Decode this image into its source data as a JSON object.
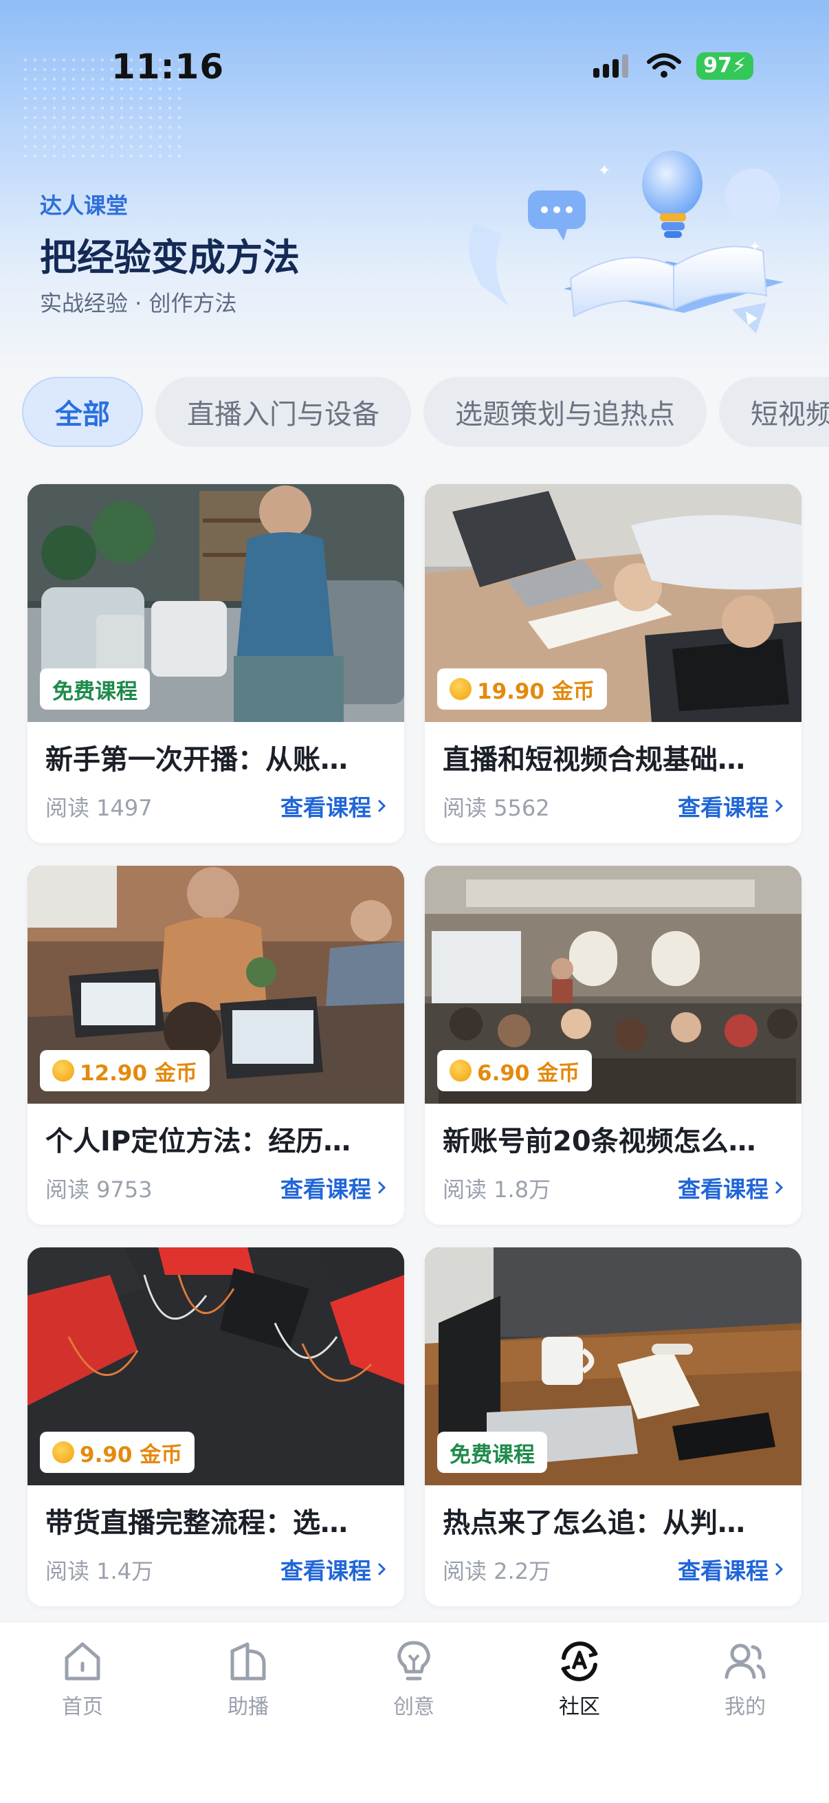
{
  "status_bar": {
    "time": "11:16",
    "battery": "97"
  },
  "hero": {
    "eyebrow": "达人课堂",
    "title": "把经验变成方法",
    "subtitle": "实战经验 · 创作方法"
  },
  "tabs": [
    {
      "label": "全部",
      "active": true
    },
    {
      "label": "直播入门与设备"
    },
    {
      "label": "选题策划与追热点"
    },
    {
      "label": "短视频"
    }
  ],
  "courses": [
    {
      "title": "新手第一次开播：从账…",
      "badge": "免费课程",
      "badge_type": "free",
      "reads": "阅读 1497",
      "link": "查看课程"
    },
    {
      "title": "直播和短视频合规基础…",
      "badge": "19.90 金币",
      "badge_type": "paid",
      "reads": "阅读 5562",
      "link": "查看课程"
    },
    {
      "title": "个人IP定位方法：经历…",
      "badge": "12.90 金币",
      "badge_type": "paid",
      "reads": "阅读 9753",
      "link": "查看课程"
    },
    {
      "title": "新账号前20条视频怎么…",
      "badge": "6.90 金币",
      "badge_type": "paid",
      "reads": "阅读 1.8万",
      "link": "查看课程"
    },
    {
      "title": "带货直播完整流程：选…",
      "badge": "9.90 金币",
      "badge_type": "paid",
      "reads": "阅读 1.4万",
      "link": "查看课程"
    },
    {
      "title": "热点来了怎么追：从判…",
      "badge": "免费课程",
      "badge_type": "free",
      "reads": "阅读 2.2万",
      "link": "查看课程"
    }
  ],
  "bottom_nav": [
    {
      "label": "首页",
      "icon": "home-icon"
    },
    {
      "label": "助播",
      "icon": "assistant-icon"
    },
    {
      "label": "创意",
      "icon": "lightbulb-icon"
    },
    {
      "label": "社区",
      "icon": "community-icon",
      "active": true
    },
    {
      "label": "我的",
      "icon": "profile-icon"
    }
  ],
  "colors": {
    "accent": "#2066d8",
    "free_badge": "#1f8a4c",
    "paid_badge": "#e38a0e"
  }
}
